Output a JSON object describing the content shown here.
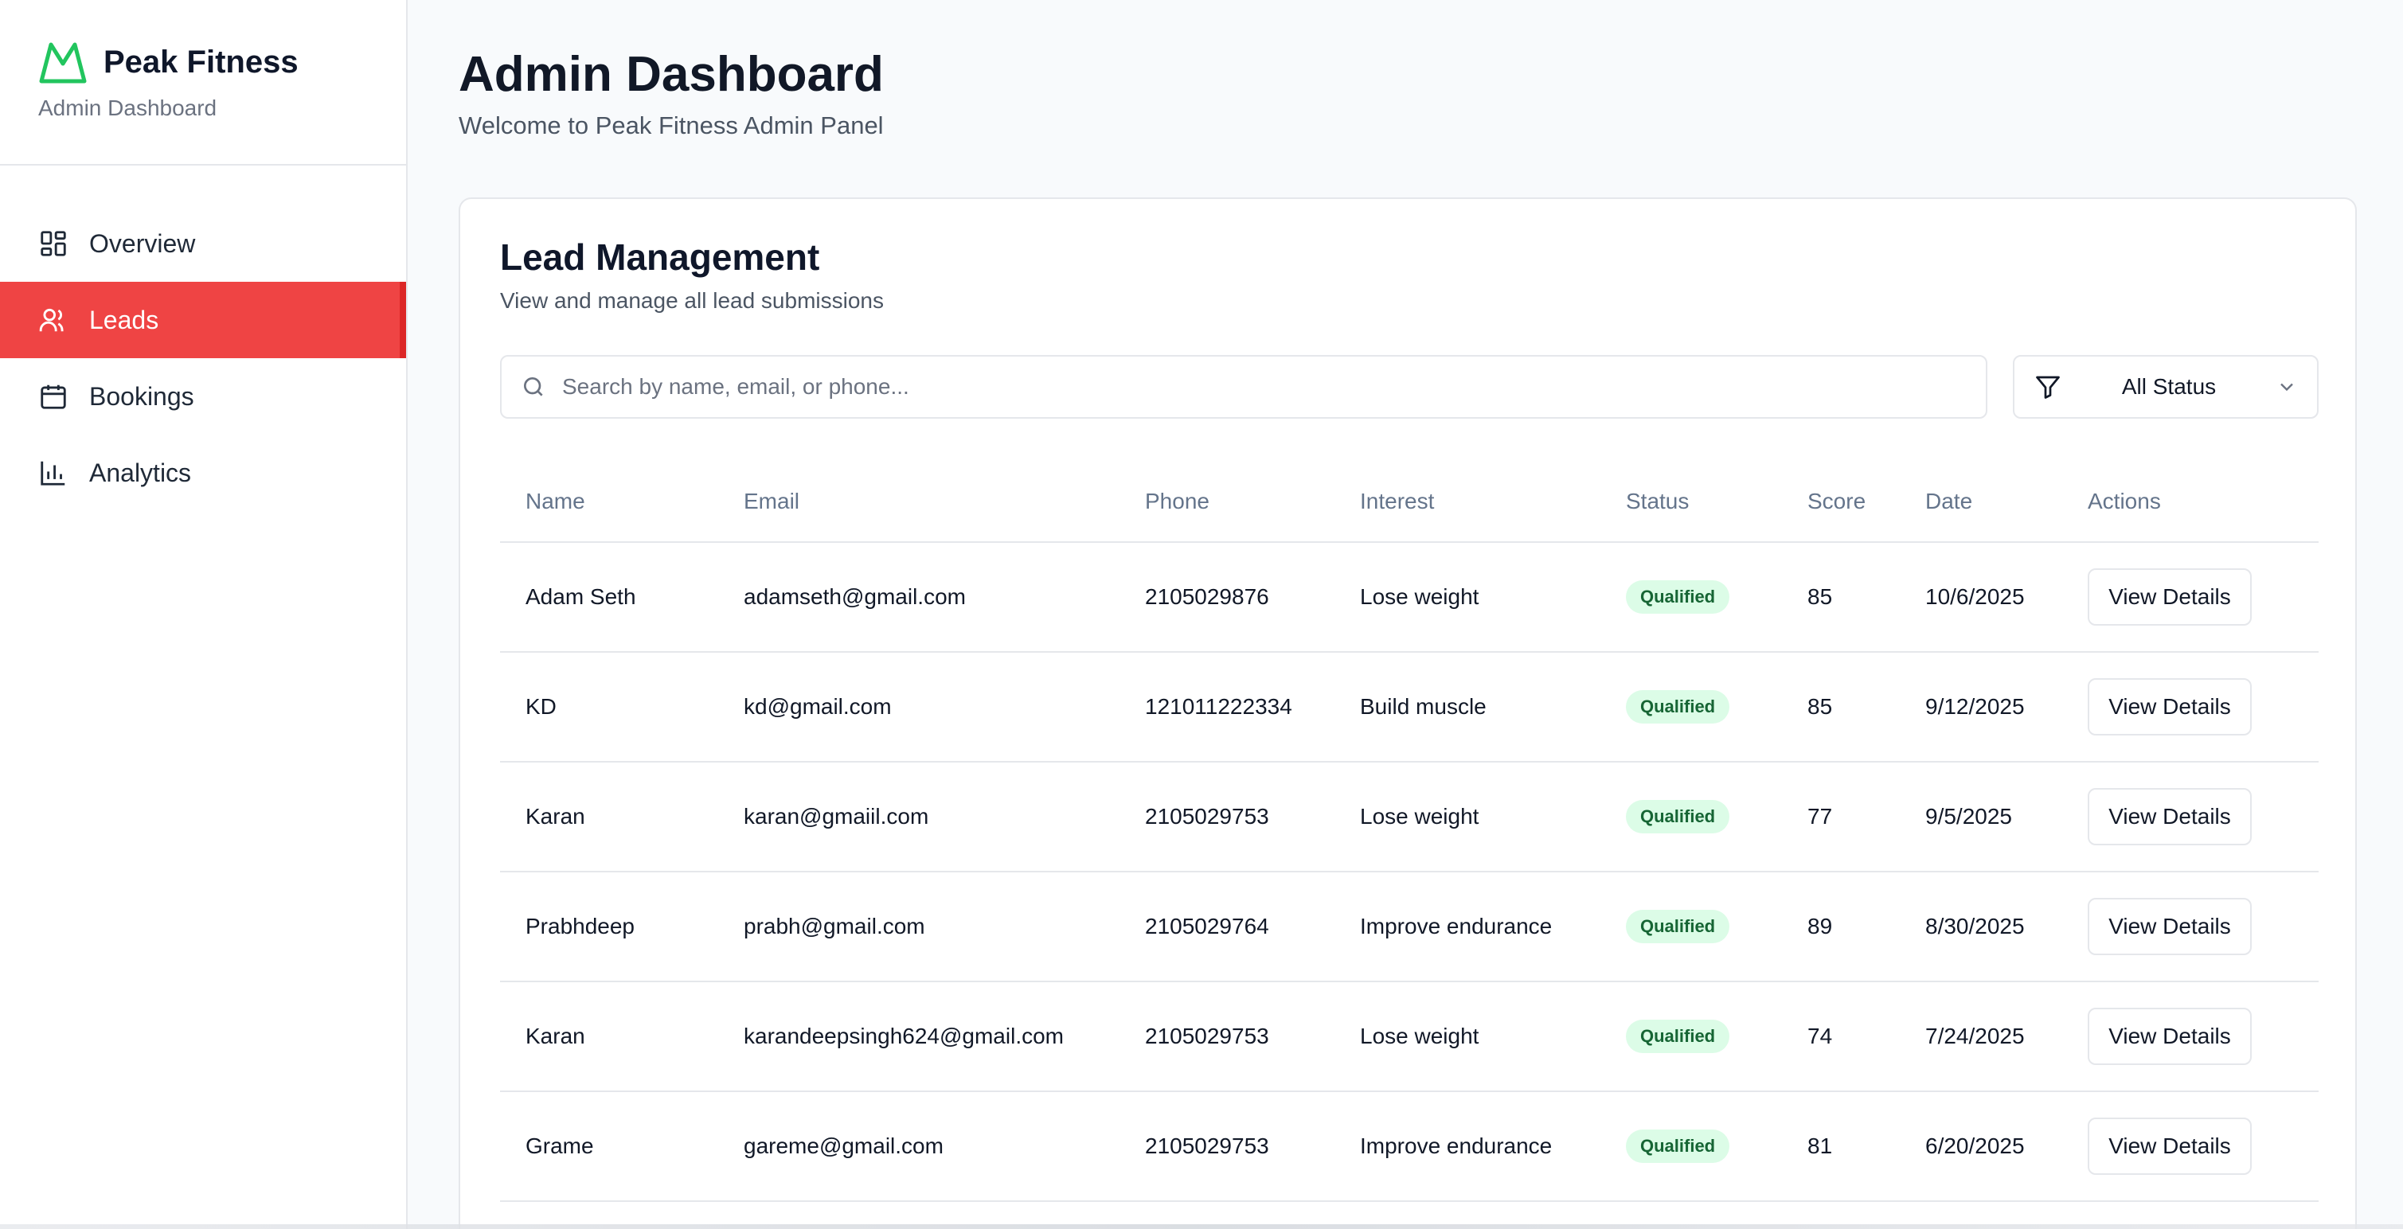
{
  "brand": {
    "name": "Peak Fitness",
    "subtitle": "Admin Dashboard",
    "accent_color": "#22c55e"
  },
  "sidebar": {
    "items": [
      {
        "label": "Overview",
        "icon": "grid-icon",
        "active": false
      },
      {
        "label": "Leads",
        "icon": "users-icon",
        "active": true
      },
      {
        "label": "Bookings",
        "icon": "calendar-icon",
        "active": false
      },
      {
        "label": "Analytics",
        "icon": "bar-chart-icon",
        "active": false
      }
    ],
    "active_color": "#ef4444"
  },
  "header": {
    "title": "Admin Dashboard",
    "subtitle": "Welcome to Peak Fitness Admin Panel"
  },
  "leads": {
    "title": "Lead Management",
    "subtitle": "View and manage all lead submissions",
    "search_placeholder": "Search by name, email, or phone...",
    "status_filter": "All Status",
    "columns": [
      "Name",
      "Email",
      "Phone",
      "Interest",
      "Status",
      "Score",
      "Date",
      "Actions"
    ],
    "rows": [
      {
        "name": "Adam Seth",
        "email": "adamseth@gmail.com",
        "phone": "2105029876",
        "interest": "Lose weight",
        "status": "Qualified",
        "score": "85",
        "date": "10/6/2025",
        "action": "View Details"
      },
      {
        "name": "KD",
        "email": "kd@gmail.com",
        "phone": "121011222334",
        "interest": "Build muscle",
        "status": "Qualified",
        "score": "85",
        "date": "9/12/2025",
        "action": "View Details"
      },
      {
        "name": "Karan",
        "email": "karan@gmaiil.com",
        "phone": "2105029753",
        "interest": "Lose weight",
        "status": "Qualified",
        "score": "77",
        "date": "9/5/2025",
        "action": "View Details"
      },
      {
        "name": "Prabhdeep",
        "email": "prabh@gmail.com",
        "phone": "2105029764",
        "interest": "Improve endurance",
        "status": "Qualified",
        "score": "89",
        "date": "8/30/2025",
        "action": "View Details"
      },
      {
        "name": "Karan",
        "email": "karandeepsingh624@gmail.com",
        "phone": "2105029753",
        "interest": "Lose weight",
        "status": "Qualified",
        "score": "74",
        "date": "7/24/2025",
        "action": "View Details"
      },
      {
        "name": "Grame",
        "email": "gareme@gmail.com",
        "phone": "2105029753",
        "interest": "Improve endurance",
        "status": "Qualified",
        "score": "81",
        "date": "6/20/2025",
        "action": "View Details"
      }
    ]
  }
}
